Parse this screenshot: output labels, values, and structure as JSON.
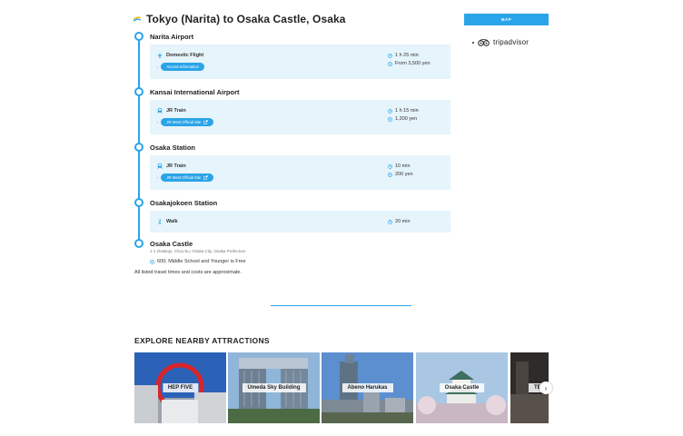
{
  "route": {
    "title": "Tokyo (Narita) to Osaka Castle, Osaka"
  },
  "map_button": {
    "label": "MAP"
  },
  "tripadvisor": {
    "label": "tripadvisor"
  },
  "stops": [
    {
      "name": "Narita Airport"
    },
    {
      "name": "Kansai International Airport"
    },
    {
      "name": "Osaka Station"
    },
    {
      "name": "Osakajokoen Station"
    },
    {
      "name": "Osaka Castle"
    }
  ],
  "segments": [
    {
      "mode": "Domestic Flight",
      "icon": "plane-icon",
      "tag": "Access Information",
      "tag_external": false,
      "duration": "1 h 25 min",
      "cost": "From 3,500 yen"
    },
    {
      "mode": "JR Train",
      "icon": "train-icon",
      "tag": "JR West Official Site",
      "tag_external": true,
      "duration": "1 h 15 min",
      "cost": "1,200 yen"
    },
    {
      "mode": "JR Train",
      "icon": "train-icon",
      "tag": "JR West Official Site",
      "tag_external": true,
      "duration": "10 min",
      "cost": "200 yen"
    },
    {
      "mode": "Walk",
      "icon": "walk-icon",
      "duration": "20 min"
    }
  ],
  "destination": {
    "address": "1-1 Osakajo, Chuo-ku, Osaka City, Osaka Prefecture",
    "fee": "600; Middle School and Younger is Free"
  },
  "note": "All listed travel times and costs are approximate.",
  "explore": {
    "heading": "EXPLORE NEARBY ATTRACTIONS",
    "cards": [
      {
        "label": "HEP FIVE"
      },
      {
        "label": "Umeda Sky Building"
      },
      {
        "label": "Abeno Harukas"
      },
      {
        "label": "Osaka Castle"
      },
      {
        "label": "TEN"
      }
    ]
  },
  "colors": {
    "accent": "#2aa4e8",
    "segment_bg": "#e6f4fb"
  }
}
